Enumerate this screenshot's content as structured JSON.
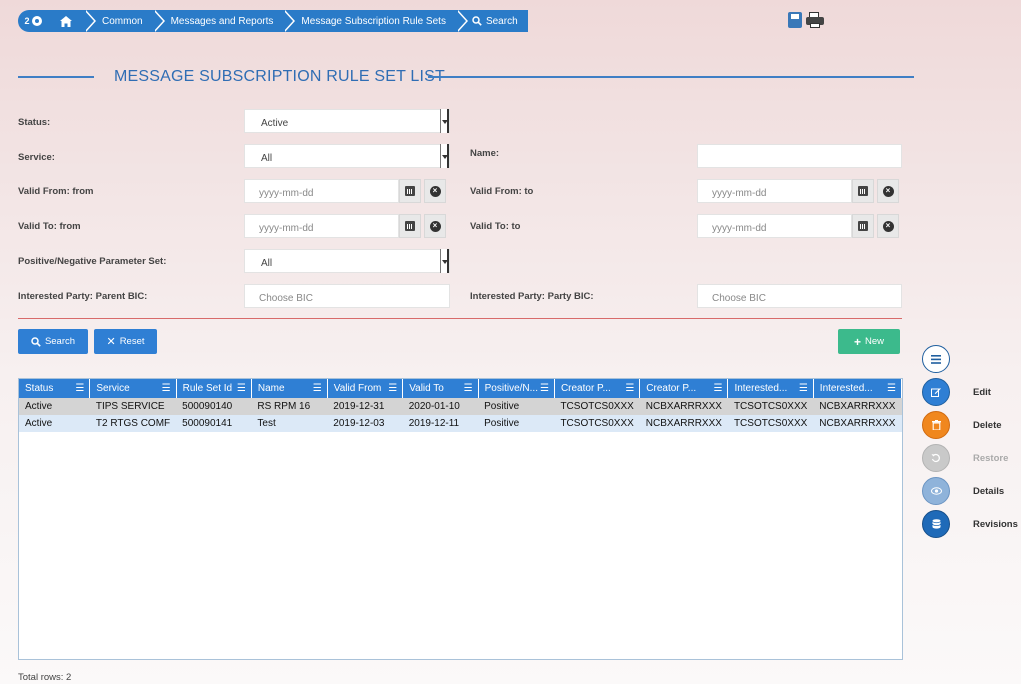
{
  "breadcrumb": {
    "badge": "2",
    "items": [
      "Common",
      "Messages and Reports",
      "Message Subscription Rule Sets"
    ],
    "search": "Search"
  },
  "title": "MESSAGE SUBSCRIPTION RULE SET LIST",
  "filters": {
    "status_label": "Status:",
    "status_value": "Active",
    "service_label": "Service:",
    "service_value": "All",
    "name_label": "Name:",
    "name_value": "",
    "valid_from_from_label": "Valid From: from",
    "valid_from_to_label": "Valid From: to",
    "valid_to_from_label": "Valid To: from",
    "valid_to_to_label": "Valid To: to",
    "date_placeholder": "yyyy-mm-dd",
    "posneg_label": "Positive/Negative Parameter Set:",
    "posneg_value": "All",
    "parent_bic_label": "Interested Party: Parent BIC:",
    "party_bic_label": "Interested Party: Party BIC:",
    "bic_placeholder": "Choose BIC"
  },
  "buttons": {
    "search": "Search",
    "reset": "Reset",
    "new": "New"
  },
  "table": {
    "columns": [
      "Status",
      "Service",
      "Rule Set Id",
      "Name",
      "Valid From",
      "Valid To",
      "Positive/N...",
      "Creator P...",
      "Creator P...",
      "Interested...",
      "Interested..."
    ],
    "rows": [
      [
        "Active",
        "TIPS SERVICE",
        "500090140",
        "RS RPM 16",
        "2019-12-31",
        "2020-01-10",
        "Positive",
        "TCSOTCS0XXX",
        "NCBXARRRXXX",
        "TCSOTCS0XXX",
        "NCBXARRRXXX"
      ],
      [
        "Active",
        "T2 RTGS COMF",
        "500090141",
        "Test",
        "2019-12-03",
        "2019-12-11",
        "Positive",
        "TCSOTCS0XXX",
        "NCBXARRRXXX",
        "TCSOTCS0XXX",
        "NCBXARRRXXX"
      ]
    ]
  },
  "total_rows": "Total rows: 2",
  "actions": {
    "edit": "Edit",
    "delete": "Delete",
    "restore": "Restore",
    "details": "Details",
    "revisions": "Revisions"
  },
  "colors": {
    "primary": "#2f7fd4",
    "green": "#3cba8c",
    "orange": "#f0871e",
    "divider": "#d86a6a"
  }
}
